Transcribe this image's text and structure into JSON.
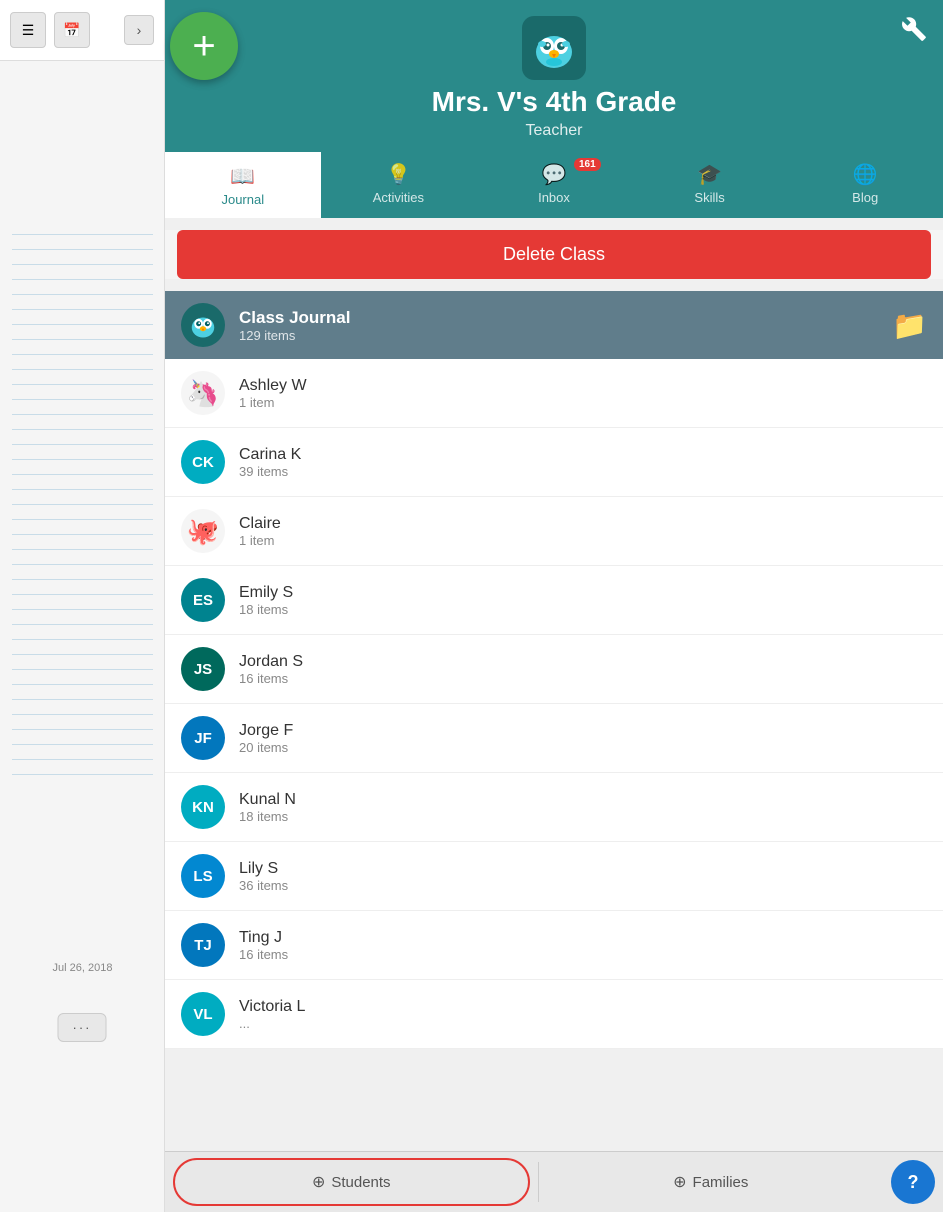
{
  "sidebar": {
    "date": "Jul 26, 2018",
    "more_label": "···"
  },
  "fab": {
    "icon": "+"
  },
  "header": {
    "title": "Mrs. V's 4th Grade",
    "subtitle": "Teacher",
    "owl_emoji": "🦉"
  },
  "tabs": [
    {
      "id": "journal",
      "label": "Journal",
      "icon": "📖",
      "active": true
    },
    {
      "id": "activities",
      "label": "Activities",
      "icon": "💡",
      "active": false
    },
    {
      "id": "inbox",
      "label": "Inbox",
      "icon": "💬",
      "active": false,
      "badge": "161"
    },
    {
      "id": "skills",
      "label": "Skills",
      "icon": "🎓",
      "active": false
    },
    {
      "id": "blog",
      "label": "Blog",
      "icon": "🌐",
      "active": false
    }
  ],
  "delete_class_label": "Delete Class",
  "class_journal": {
    "name": "Class Journal",
    "count": "129 items"
  },
  "students": [
    {
      "id": "ashley-w",
      "name": "Ashley W",
      "count": "1 item",
      "initials": null,
      "emoji": "🦄",
      "color": "#f5f5f5"
    },
    {
      "id": "carina-k",
      "name": "Carina K",
      "count": "39 items",
      "initials": "CK",
      "color": "#00acc1"
    },
    {
      "id": "claire",
      "name": "Claire",
      "count": "1 item",
      "initials": null,
      "emoji": "🐙",
      "color": "#f5f5f5"
    },
    {
      "id": "emily-s",
      "name": "Emily S",
      "count": "18 items",
      "initials": "ES",
      "color": "#00838f"
    },
    {
      "id": "jordan-s",
      "name": "Jordan S",
      "count": "16 items",
      "initials": "JS",
      "color": "#00695c"
    },
    {
      "id": "jorge-f",
      "name": "Jorge F",
      "count": "20 items",
      "initials": "JF",
      "color": "#0277bd"
    },
    {
      "id": "kunal-n",
      "name": "Kunal N",
      "count": "18 items",
      "initials": "KN",
      "color": "#00acc1"
    },
    {
      "id": "lily-s",
      "name": "Lily S",
      "count": "36 items",
      "initials": "LS",
      "color": "#0288d1"
    },
    {
      "id": "ting-j",
      "name": "Ting J",
      "count": "16 items",
      "initials": "TJ",
      "color": "#0277bd"
    },
    {
      "id": "victoria-l",
      "name": "Victoria L",
      "count": "...",
      "initials": "VL",
      "color": "#00acc1"
    }
  ],
  "bottom_bar": {
    "students_label": "Students",
    "families_label": "Families",
    "help_label": "?"
  }
}
